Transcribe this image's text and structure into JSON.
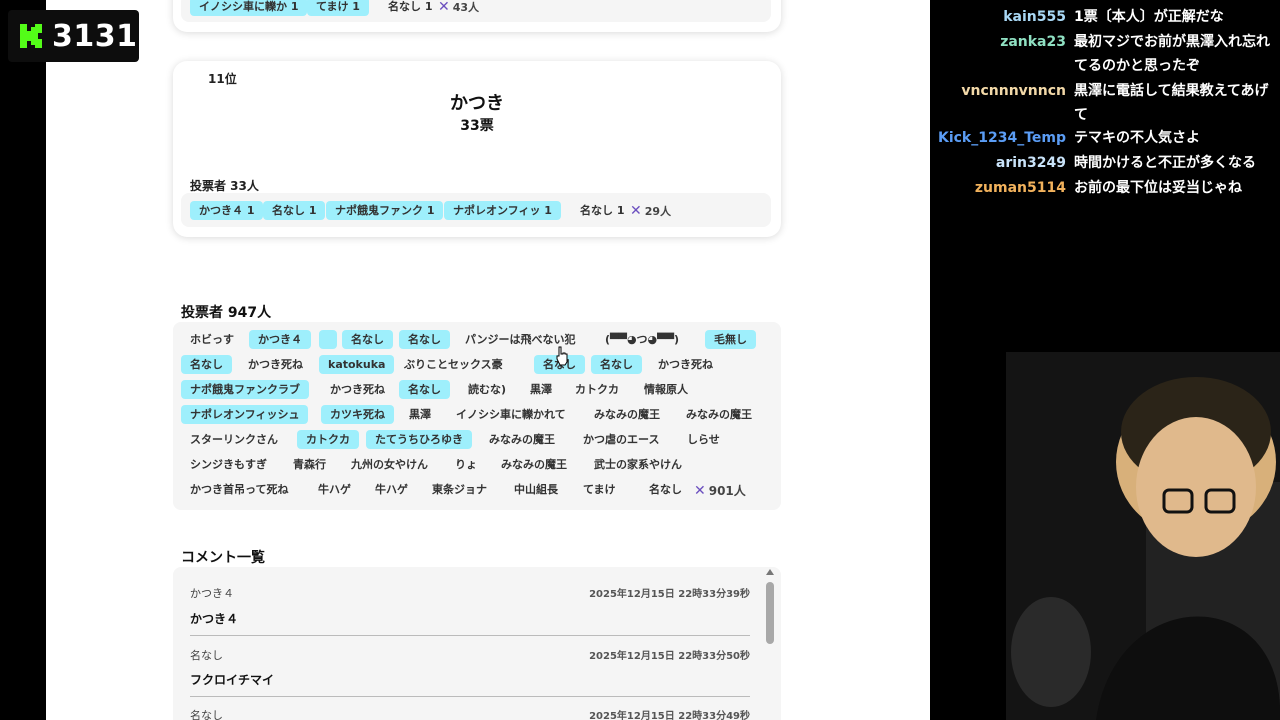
{
  "overlay": {
    "viewer_count": "3131",
    "logo_letter": "K"
  },
  "prev_card": {
    "chips": [
      "イノシシ車に轢か 1",
      "てまけ 1"
    ],
    "plain_chip": "名なし 1",
    "others_count": "43人"
  },
  "rank_card": {
    "rank": "11位",
    "name": "かつき",
    "votes": "33票",
    "voters_label": "投票者 33人",
    "chips": [
      "かつき４ 1",
      "名なし 1",
      "ナポ餓鬼ファンク 1",
      "ナポレオンフィッ 1"
    ],
    "plain_chip": "名なし 1",
    "others_count": "29人"
  },
  "voters_section": {
    "title": "投票者 947人",
    "rows": [
      [
        "ホビっす",
        "かつき４",
        "",
        "名なし",
        "名なし",
        "パンジーは飛べない犯",
        "(▀▀◕つ◕▀▀)",
        "毛無し"
      ],
      [
        "名なし",
        "かつき死ね",
        "katokuka",
        "ぶりことセックス豪",
        "名なし",
        "名なし",
        "かつき死ね"
      ],
      [
        "ナポ餓鬼ファンクラブ",
        "かつき死ね",
        "名なし",
        "読むな)",
        "黒澤",
        "カトクカ",
        "情報原人"
      ],
      [
        "ナポレオンフィッシュ",
        "カツキ死ね",
        "黒澤",
        "イノシシ車に轢かれて",
        "みなみの魔王",
        "みなみの魔王"
      ],
      [
        "スターリンクさん",
        "カトクカ",
        "たてうちひろゆき",
        "みなみの魔王",
        "かつ虐のエース",
        "しらせ"
      ],
      [
        "シンジきもすぎ",
        "青森行",
        "九州の女やけん",
        "りょ",
        "みなみの魔王",
        "武士の家系やけん"
      ],
      [
        "かつき首吊って死ね",
        "牛ハゲ",
        "牛ハゲ",
        "東条ジョナ",
        "中山組長",
        "てまけ",
        "名なし"
      ]
    ],
    "others_count": "901人"
  },
  "comments": {
    "title": "コメント一覧",
    "items": [
      {
        "user": "かつき４",
        "date": "2025年12月15日 22時33分39秒",
        "text": "かつき４"
      },
      {
        "user": "名なし",
        "date": "2025年12月15日 22時33分50秒",
        "text": "フクロイチマイ"
      },
      {
        "user": "名なし",
        "date": "2025年12月15日 22時33分49秒",
        "text": ""
      }
    ]
  },
  "chat": [
    {
      "user": "kain555",
      "color": "#a9d8f5",
      "message": "1票〔本人〕が正解だな"
    },
    {
      "user": "zanka23",
      "color": "#8fe0c2",
      "message": "最初マジでお前が黒澤入れ忘れてるのかと思ったぞ"
    },
    {
      "user": "vncnnnvnncn",
      "color": "#f3d9a8",
      "message": "黒澤に電話して結果教えてあげて"
    },
    {
      "user": "Kick_1234_Temp",
      "color": "#5b9df5",
      "message": "テマキの不人気さよ"
    },
    {
      "user": "arin3249",
      "color": "#c9e3f9",
      "message": "時間かけると不正が多くなる"
    },
    {
      "user": "zuman5114",
      "color": "#f2b25c",
      "message": "お前の最下位は妥当じゃね"
    }
  ]
}
